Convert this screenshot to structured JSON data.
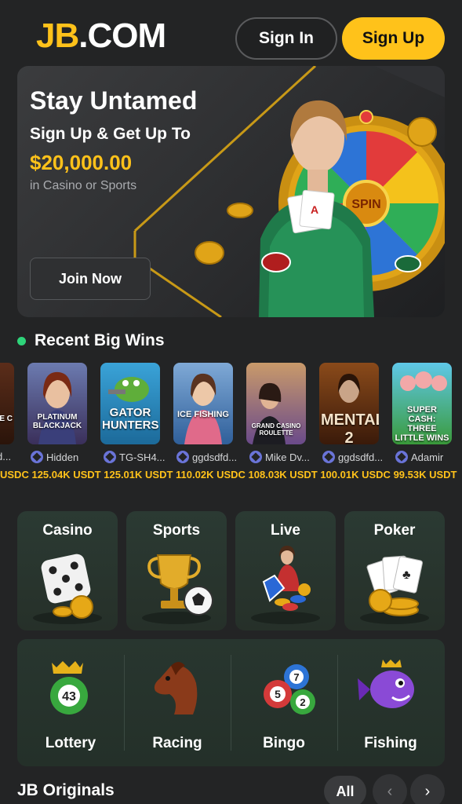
{
  "header": {
    "logo_jb": "JB",
    "logo_com": ".COM",
    "signin_label": "Sign In",
    "signup_label": "Sign Up"
  },
  "hero": {
    "title": "Stay Untamed",
    "subtitle": "Sign Up & Get Up To",
    "amount": "$20,000.00",
    "note": "in Casino or Sports",
    "join_label": "Join Now",
    "wheel_text": "SPIN"
  },
  "recent_wins": {
    "title": "Recent Big Wins",
    "items": [
      {
        "game": "VE C",
        "user": "d...",
        "amount": "USDC"
      },
      {
        "game": "PLATINUM BLACKJACK",
        "user": "Hidden",
        "amount": "125.04K USDT"
      },
      {
        "game": "GATOR HUNTERS",
        "user": "TG-SH4...",
        "amount": "125.01K USDT"
      },
      {
        "game": "ICE FISHING",
        "user": "ggdsdfd...",
        "amount": "110.02K USDC"
      },
      {
        "game": "GRAND CASINO ROULETTE",
        "user": "Mike Dv...",
        "amount": "108.03K USDT"
      },
      {
        "game": "MENTAL 2",
        "user": "ggdsdfd...",
        "amount": "100.01K USDC"
      },
      {
        "game": "SUPER CASH: THREE LITTLE WINS",
        "user": "Adamir",
        "amount": "99.53K USDT"
      }
    ]
  },
  "categories": {
    "top": [
      {
        "label": "Casino",
        "icon": "dice-icon"
      },
      {
        "label": "Sports",
        "icon": "trophy-icon"
      },
      {
        "label": "Live",
        "icon": "live-dealer-icon"
      },
      {
        "label": "Poker",
        "icon": "playing-cards-icon"
      }
    ],
    "bottom": [
      {
        "label": "Lottery",
        "icon": "lottery-ball-icon",
        "ball_number": "43"
      },
      {
        "label": "Racing",
        "icon": "horse-icon"
      },
      {
        "label": "Bingo",
        "icon": "bingo-balls-icon",
        "balls": [
          "7",
          "5",
          "2"
        ]
      },
      {
        "label": "Fishing",
        "icon": "fish-icon"
      }
    ]
  },
  "originals": {
    "title": "JB Originals",
    "all_label": "All",
    "prev_icon": "‹",
    "next_icon": "›"
  },
  "colors": {
    "accent": "#ffc21a",
    "background": "#232425",
    "live_dot": "#2ed47a",
    "category_bg": "#2b3a33"
  }
}
